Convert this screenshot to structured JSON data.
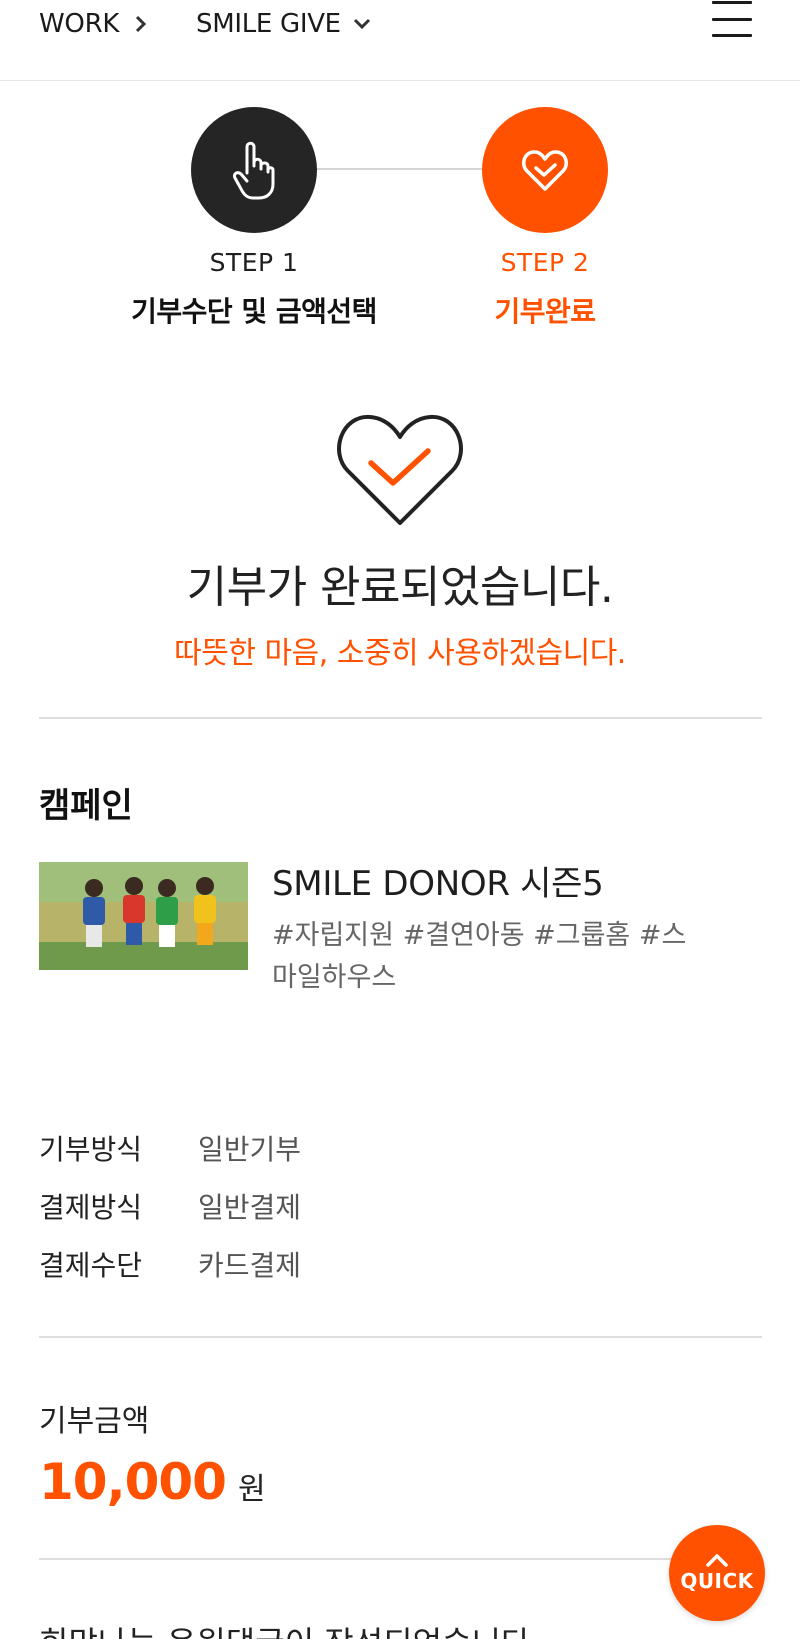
{
  "nav": {
    "breadcrumb": [
      "WORK",
      "SMILE GIVE"
    ],
    "icons": {
      "separator": "chevron-right-icon",
      "dropdown": "chevron-down-icon",
      "menu": "hamburger-menu-icon"
    }
  },
  "steps": [
    {
      "label": "STEP 1",
      "title": "기부수단 및 금액선택",
      "icon": "hand-pointer-icon",
      "active": false
    },
    {
      "label": "STEP 2",
      "title": "기부완료",
      "icon": "heart-check-icon",
      "active": true
    }
  ],
  "complete": {
    "title": "기부가 완료되었습니다.",
    "subtitle": "따뜻한 마음, 소중히 사용하겠습니다."
  },
  "campaign": {
    "section_title": "캠페인",
    "name": "SMILE DONOR 시즌5",
    "tags": "#자립지원 #결연아동 #그룹홈 #스마일하우스"
  },
  "info": [
    {
      "key": "기부방식",
      "value": "일반기부"
    },
    {
      "key": "결제방식",
      "value": "일반결제"
    },
    {
      "key": "결제수단",
      "value": "카드결제"
    }
  ],
  "amount": {
    "label": "기부금액",
    "value": "10,000",
    "unit": "원"
  },
  "bottom": {
    "text": "희망나눔 응원댓글이 작성되었습니다."
  },
  "quick": {
    "label": "QUICK"
  },
  "colors": {
    "accent": "#ff5100",
    "dark": "#252525",
    "divider": "#dedede"
  }
}
